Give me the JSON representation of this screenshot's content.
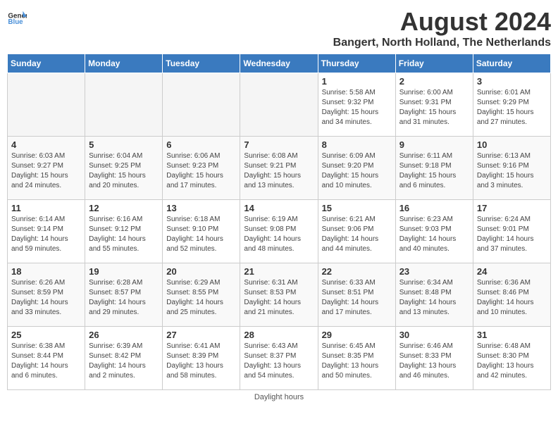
{
  "header": {
    "logo_general": "General",
    "logo_blue": "Blue",
    "month_title": "August 2024",
    "location": "Bangert, North Holland, The Netherlands"
  },
  "days_of_week": [
    "Sunday",
    "Monday",
    "Tuesday",
    "Wednesday",
    "Thursday",
    "Friday",
    "Saturday"
  ],
  "footer": {
    "daylight_label": "Daylight hours"
  },
  "weeks": [
    {
      "cells": [
        {
          "day": "",
          "empty": true
        },
        {
          "day": "",
          "empty": true
        },
        {
          "day": "",
          "empty": true
        },
        {
          "day": "",
          "empty": true
        },
        {
          "day": "1",
          "sunrise": "Sunrise: 5:58 AM",
          "sunset": "Sunset: 9:32 PM",
          "daylight": "Daylight: 15 hours and 34 minutes."
        },
        {
          "day": "2",
          "sunrise": "Sunrise: 6:00 AM",
          "sunset": "Sunset: 9:31 PM",
          "daylight": "Daylight: 15 hours and 31 minutes."
        },
        {
          "day": "3",
          "sunrise": "Sunrise: 6:01 AM",
          "sunset": "Sunset: 9:29 PM",
          "daylight": "Daylight: 15 hours and 27 minutes."
        }
      ]
    },
    {
      "cells": [
        {
          "day": "4",
          "sunrise": "Sunrise: 6:03 AM",
          "sunset": "Sunset: 9:27 PM",
          "daylight": "Daylight: 15 hours and 24 minutes."
        },
        {
          "day": "5",
          "sunrise": "Sunrise: 6:04 AM",
          "sunset": "Sunset: 9:25 PM",
          "daylight": "Daylight: 15 hours and 20 minutes."
        },
        {
          "day": "6",
          "sunrise": "Sunrise: 6:06 AM",
          "sunset": "Sunset: 9:23 PM",
          "daylight": "Daylight: 15 hours and 17 minutes."
        },
        {
          "day": "7",
          "sunrise": "Sunrise: 6:08 AM",
          "sunset": "Sunset: 9:21 PM",
          "daylight": "Daylight: 15 hours and 13 minutes."
        },
        {
          "day": "8",
          "sunrise": "Sunrise: 6:09 AM",
          "sunset": "Sunset: 9:20 PM",
          "daylight": "Daylight: 15 hours and 10 minutes."
        },
        {
          "day": "9",
          "sunrise": "Sunrise: 6:11 AM",
          "sunset": "Sunset: 9:18 PM",
          "daylight": "Daylight: 15 hours and 6 minutes."
        },
        {
          "day": "10",
          "sunrise": "Sunrise: 6:13 AM",
          "sunset": "Sunset: 9:16 PM",
          "daylight": "Daylight: 15 hours and 3 minutes."
        }
      ]
    },
    {
      "cells": [
        {
          "day": "11",
          "sunrise": "Sunrise: 6:14 AM",
          "sunset": "Sunset: 9:14 PM",
          "daylight": "Daylight: 14 hours and 59 minutes."
        },
        {
          "day": "12",
          "sunrise": "Sunrise: 6:16 AM",
          "sunset": "Sunset: 9:12 PM",
          "daylight": "Daylight: 14 hours and 55 minutes."
        },
        {
          "day": "13",
          "sunrise": "Sunrise: 6:18 AM",
          "sunset": "Sunset: 9:10 PM",
          "daylight": "Daylight: 14 hours and 52 minutes."
        },
        {
          "day": "14",
          "sunrise": "Sunrise: 6:19 AM",
          "sunset": "Sunset: 9:08 PM",
          "daylight": "Daylight: 14 hours and 48 minutes."
        },
        {
          "day": "15",
          "sunrise": "Sunrise: 6:21 AM",
          "sunset": "Sunset: 9:06 PM",
          "daylight": "Daylight: 14 hours and 44 minutes."
        },
        {
          "day": "16",
          "sunrise": "Sunrise: 6:23 AM",
          "sunset": "Sunset: 9:03 PM",
          "daylight": "Daylight: 14 hours and 40 minutes."
        },
        {
          "day": "17",
          "sunrise": "Sunrise: 6:24 AM",
          "sunset": "Sunset: 9:01 PM",
          "daylight": "Daylight: 14 hours and 37 minutes."
        }
      ]
    },
    {
      "cells": [
        {
          "day": "18",
          "sunrise": "Sunrise: 6:26 AM",
          "sunset": "Sunset: 8:59 PM",
          "daylight": "Daylight: 14 hours and 33 minutes."
        },
        {
          "day": "19",
          "sunrise": "Sunrise: 6:28 AM",
          "sunset": "Sunset: 8:57 PM",
          "daylight": "Daylight: 14 hours and 29 minutes."
        },
        {
          "day": "20",
          "sunrise": "Sunrise: 6:29 AM",
          "sunset": "Sunset: 8:55 PM",
          "daylight": "Daylight: 14 hours and 25 minutes."
        },
        {
          "day": "21",
          "sunrise": "Sunrise: 6:31 AM",
          "sunset": "Sunset: 8:53 PM",
          "daylight": "Daylight: 14 hours and 21 minutes."
        },
        {
          "day": "22",
          "sunrise": "Sunrise: 6:33 AM",
          "sunset": "Sunset: 8:51 PM",
          "daylight": "Daylight: 14 hours and 17 minutes."
        },
        {
          "day": "23",
          "sunrise": "Sunrise: 6:34 AM",
          "sunset": "Sunset: 8:48 PM",
          "daylight": "Daylight: 14 hours and 13 minutes."
        },
        {
          "day": "24",
          "sunrise": "Sunrise: 6:36 AM",
          "sunset": "Sunset: 8:46 PM",
          "daylight": "Daylight: 14 hours and 10 minutes."
        }
      ]
    },
    {
      "cells": [
        {
          "day": "25",
          "sunrise": "Sunrise: 6:38 AM",
          "sunset": "Sunset: 8:44 PM",
          "daylight": "Daylight: 14 hours and 6 minutes."
        },
        {
          "day": "26",
          "sunrise": "Sunrise: 6:39 AM",
          "sunset": "Sunset: 8:42 PM",
          "daylight": "Daylight: 14 hours and 2 minutes."
        },
        {
          "day": "27",
          "sunrise": "Sunrise: 6:41 AM",
          "sunset": "Sunset: 8:39 PM",
          "daylight": "Daylight: 13 hours and 58 minutes."
        },
        {
          "day": "28",
          "sunrise": "Sunrise: 6:43 AM",
          "sunset": "Sunset: 8:37 PM",
          "daylight": "Daylight: 13 hours and 54 minutes."
        },
        {
          "day": "29",
          "sunrise": "Sunrise: 6:45 AM",
          "sunset": "Sunset: 8:35 PM",
          "daylight": "Daylight: 13 hours and 50 minutes."
        },
        {
          "day": "30",
          "sunrise": "Sunrise: 6:46 AM",
          "sunset": "Sunset: 8:33 PM",
          "daylight": "Daylight: 13 hours and 46 minutes."
        },
        {
          "day": "31",
          "sunrise": "Sunrise: 6:48 AM",
          "sunset": "Sunset: 8:30 PM",
          "daylight": "Daylight: 13 hours and 42 minutes."
        }
      ]
    }
  ]
}
